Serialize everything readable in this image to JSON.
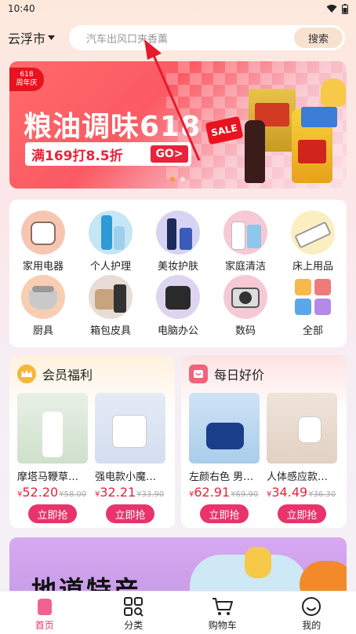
{
  "status_bar": {
    "time": "10:40"
  },
  "header": {
    "city": "云浮市",
    "search_placeholder": "汽车出风口夹香薰",
    "search_button": "搜索"
  },
  "banner": {
    "badge": "618\n周年庆",
    "title": "粮油调味618",
    "promo": "满169打8.5折",
    "go": "GO>",
    "sale": "SALE",
    "active_dot": 0
  },
  "categories": [
    {
      "label": "家用电器",
      "color": "#f7c6b2"
    },
    {
      "label": "个人护理",
      "color": "#c7e6f5"
    },
    {
      "label": "美妆护肤",
      "color": "#d7d3f2"
    },
    {
      "label": "家庭清洁",
      "color": "#f6c9d4"
    },
    {
      "label": "床上用品",
      "color": "#fbeec0"
    },
    {
      "label": "厨具",
      "color": "#f7cdb3"
    },
    {
      "label": "箱包皮具",
      "color": "#e7dcd6"
    },
    {
      "label": "电脑办公",
      "color": "#dcd5ef"
    },
    {
      "label": "数码",
      "color": "#f6c9d4"
    },
    {
      "label": "全部",
      "color": "#ffffff"
    }
  ],
  "member_section": {
    "title": "会员福利",
    "products": [
      {
        "name": "摩塔马鞭草…",
        "yen": "¥",
        "price": "52.20",
        "old_price": "¥58.00",
        "buy": "立即抢"
      },
      {
        "name": "强电款小魔…",
        "yen": "¥",
        "price": "32.21",
        "old_price": "¥33.90",
        "buy": "立即抢"
      }
    ]
  },
  "daily_section": {
    "title": "每日好价",
    "products": [
      {
        "name": "左颜右色 男…",
        "yen": "¥",
        "price": "62.91",
        "old_price": "¥69.90",
        "buy": "立即抢"
      },
      {
        "name": "人体感应款…",
        "yen": "¥",
        "price": "34.49",
        "old_price": "¥36.30",
        "buy": "立即抢"
      }
    ]
  },
  "bottom_banner": {
    "title": "地道特产"
  },
  "tabbar": [
    {
      "label": "首页",
      "active": true
    },
    {
      "label": "分类",
      "active": false
    },
    {
      "label": "购物车",
      "active": false
    },
    {
      "label": "我的",
      "active": false
    }
  ],
  "colors": {
    "accent": "#e8336b",
    "price": "#e8233a",
    "banner_red": "#fb5a63"
  }
}
